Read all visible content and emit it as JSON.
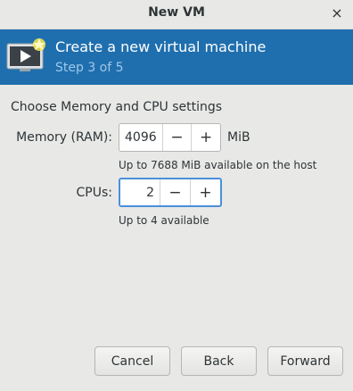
{
  "window": {
    "title": "New VM",
    "close_icon": "×"
  },
  "banner": {
    "icon": "new-vm-icon",
    "heading": "Create a new virtual machine",
    "step": "Step 3 of 5",
    "background": "#1f6fae"
  },
  "section_title": "Choose Memory and CPU settings",
  "memory": {
    "label": "Memory (RAM):",
    "value": "4096",
    "unit": "MiB",
    "hint": "Up to 7688 MiB available on the host",
    "decrement": "−",
    "increment": "+"
  },
  "cpus": {
    "label": "CPUs:",
    "value": "2",
    "hint": "Up to 4 available",
    "decrement": "−",
    "increment": "+"
  },
  "buttons": {
    "cancel": "Cancel",
    "back": "Back",
    "forward": "Forward"
  }
}
